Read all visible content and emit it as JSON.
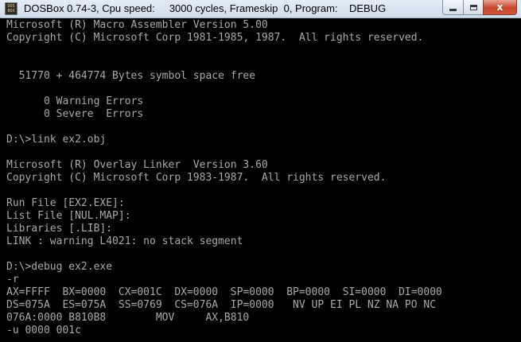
{
  "window": {
    "icon_line1": "DOS",
    "icon_line2": "BOX",
    "title": "DOSBox 0.74-3, Cpu speed:     3000 cycles, Frameskip  0, Program:    DEBUG",
    "close_symbol": "x"
  },
  "console": {
    "lines": [
      "Microsoft (R) Macro Assembler Version 5.00",
      "Copyright (C) Microsoft Corp 1981-1985, 1987.  All rights reserved.",
      "",
      "",
      "  51770 + 464774 Bytes symbol space free",
      "",
      "      0 Warning Errors",
      "      0 Severe  Errors",
      "",
      "D:\\>link ex2.obj",
      "",
      "Microsoft (R) Overlay Linker  Version 3.60",
      "Copyright (C) Microsoft Corp 1983-1987.  All rights reserved.",
      "",
      "Run File [EX2.EXE]:",
      "List File [NUL.MAP]:",
      "Libraries [.LIB]:",
      "LINK : warning L4021: no stack segment",
      "",
      "D:\\>debug ex2.exe",
      "-r",
      "AX=FFFF  BX=0000  CX=001C  DX=0000  SP=0000  BP=0000  SI=0000  DI=0000",
      "DS=075A  ES=075A  SS=0769  CS=076A  IP=0000   NV UP EI PL NZ NA PO NC",
      "076A:0000 B810B8        MOV     AX,B810",
      "-u 0000 001c"
    ]
  }
}
